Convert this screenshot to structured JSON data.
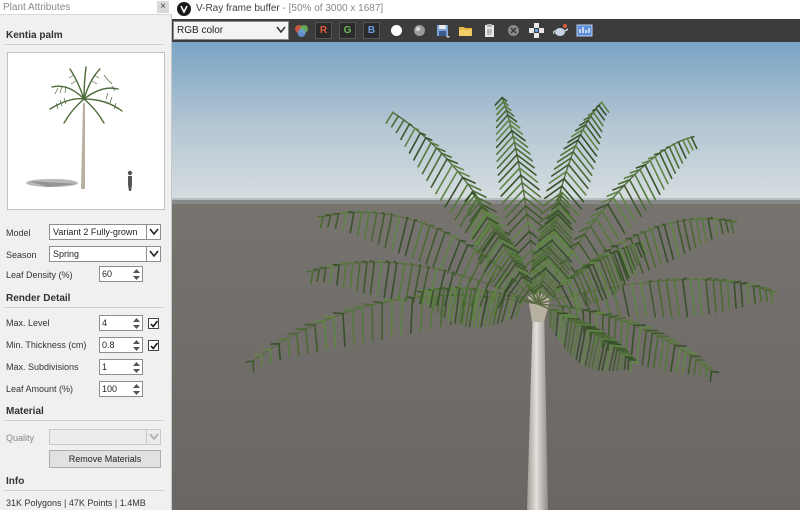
{
  "plant_panel": {
    "title": "Plant Attributes",
    "close_glyph": "×",
    "plant_name": "Kentia palm",
    "model_label": "Model",
    "model_value": "Variant 2 Fully-grown",
    "season_label": "Season",
    "season_value": "Spring",
    "leaf_density_label": "Leaf Density (%)",
    "leaf_density_value": "60",
    "render_detail_header": "Render Detail",
    "max_level_label": "Max. Level",
    "max_level_value": "4",
    "max_level_checked": true,
    "min_thickness_label": "Min. Thickness (cm)",
    "min_thickness_value": "0.8",
    "min_thickness_checked": true,
    "max_subdivisions_label": "Max. Subdivisions",
    "max_subdivisions_value": "1",
    "leaf_amount_label": "Leaf Amount (%)",
    "leaf_amount_value": "100",
    "material_header": "Material",
    "quality_label": "Quality",
    "quality_value": "",
    "remove_materials_label": "Remove Materials",
    "info_header": "Info",
    "info_text": "31K Polygons | 47K Points | 1.4MB"
  },
  "frame_buffer": {
    "title": "V-Ray frame buffer",
    "subtitle": "- [50% of 3000 x 1687]",
    "channel_value": "RGB color",
    "r_label": "R",
    "g_label": "G",
    "b_label": "B",
    "colors": {
      "r": "#e05a3a",
      "g": "#6fb85a",
      "b": "#6a9ce0",
      "toolbar_bg": "#3c3c3c"
    },
    "toolbar_icons": [
      "channels-icon",
      "white-circle-icon",
      "grey-sphere-icon",
      "save-icon",
      "open-folder-icon",
      "clipboard-icon",
      "clear-icon",
      "track-mouse-icon",
      "teapot-render-icon",
      "stats-icon"
    ]
  }
}
